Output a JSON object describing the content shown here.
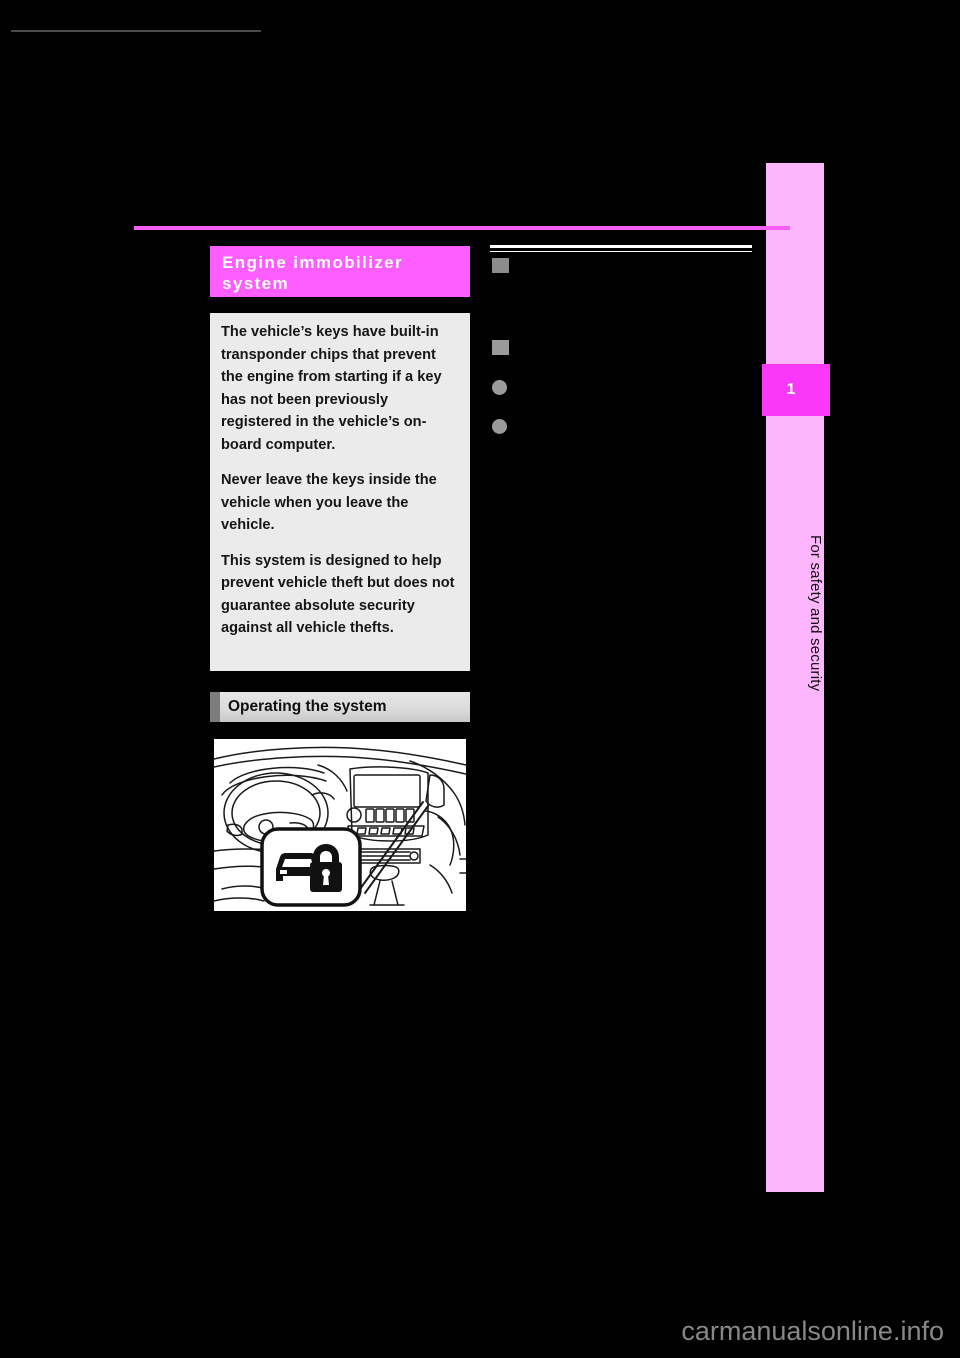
{
  "page": {
    "background_color": "#000000",
    "accent_magenta": "#fd5efd",
    "strip_pink": "#fdb6fb",
    "rule_color": "#f45ef4"
  },
  "chapter": {
    "number": "1",
    "title": "For safety and security"
  },
  "section": {
    "title_line_1": "Engine immobilizer",
    "title_line_2": "system",
    "intro_paragraphs": [
      "The vehicle’s keys have built-in transponder chips that prevent the engine from starting if a key has not been previously registered in the vehicle’s on-board computer.",
      "Never leave the keys inside the vehicle when you leave the vehicle.",
      "This system is designed to help prevent vehicle theft but does not guarantee absolute security against all vehicle thefts."
    ]
  },
  "subsection": {
    "heading": "Operating the system"
  },
  "illustration": {
    "caption": "",
    "icon_name": "car-lock-security-indicator-icon"
  },
  "right_column": {
    "items": [
      {
        "marker": "square-dark",
        "text": ""
      },
      {
        "marker": "square",
        "text": ""
      },
      {
        "marker": "dot",
        "text": ""
      },
      {
        "marker": "dot",
        "text": ""
      }
    ]
  },
  "footer": {
    "watermark": "carmanualsonline.info"
  }
}
